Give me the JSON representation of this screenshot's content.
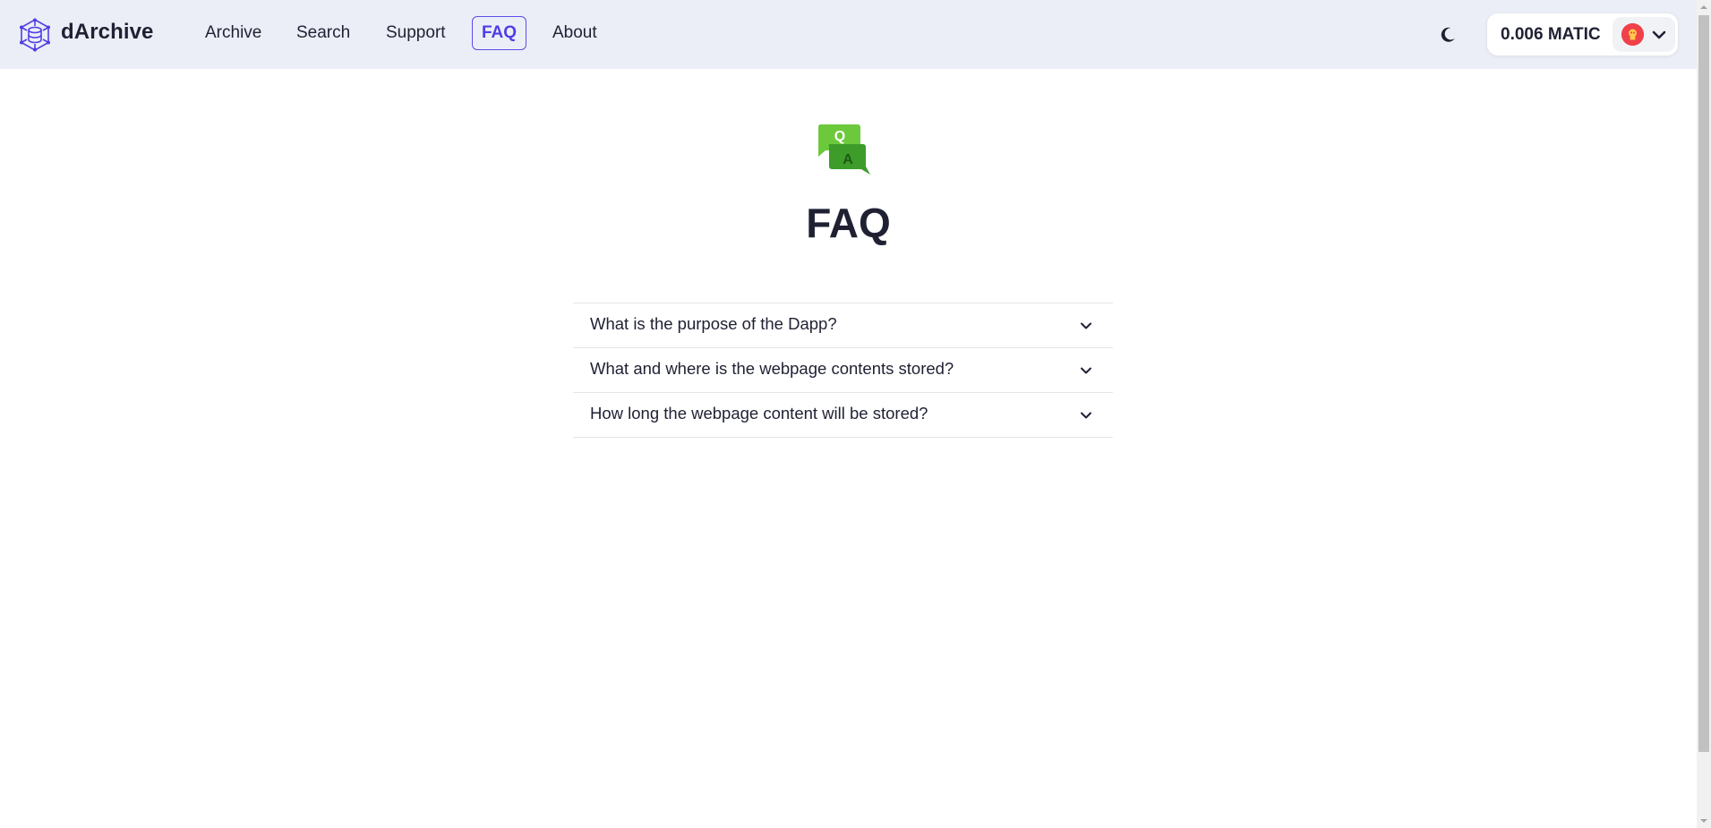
{
  "navbar": {
    "brand": "dArchive",
    "logo_icon": "database-network-icon",
    "items": [
      {
        "label": "Archive",
        "active": false
      },
      {
        "label": "Search",
        "active": false
      },
      {
        "label": "Support",
        "active": false
      },
      {
        "label": "FAQ",
        "active": true
      },
      {
        "label": "About",
        "active": false
      }
    ],
    "theme_icon": "moon-icon",
    "wallet": {
      "balance": "0.006 MATIC",
      "avatar_icon": "avatar-icon",
      "chevron_icon": "chevron-down-icon"
    }
  },
  "main": {
    "icon": "qa-bubbles-icon",
    "icon_q": "Q",
    "icon_a": "A",
    "title": "FAQ",
    "questions": [
      {
        "question": "What is the purpose of the Dapp?"
      },
      {
        "question": "What and where is the webpage contents stored?"
      },
      {
        "question": "How long the webpage content will be stored?"
      }
    ]
  },
  "colors": {
    "accent": "#4f3ee6",
    "navbar_bg": "#ebeef6",
    "text": "#1f2133",
    "qa_green_light": "#6cc93c",
    "qa_green_dark": "#3d9c2a",
    "avatar_red": "#f0404a"
  }
}
